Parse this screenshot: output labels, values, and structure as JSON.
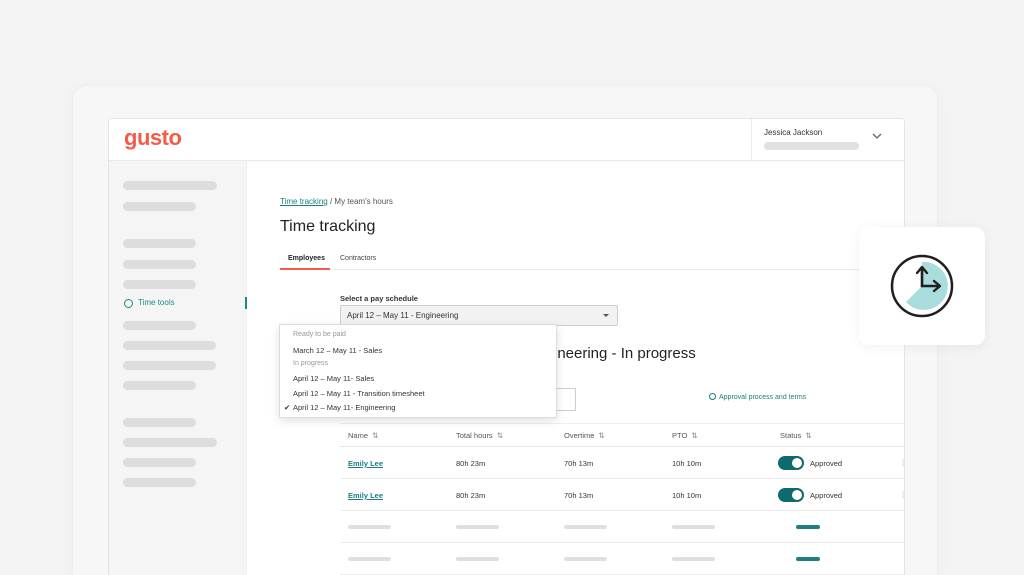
{
  "brand": {
    "logo_text": "gusto",
    "accent": "#f45d48",
    "teal": "#1a8080"
  },
  "header": {
    "user_name": "Jessica Jackson",
    "chevron_icon": "chevron-down-icon"
  },
  "sidebar": {
    "active_item": {
      "label": "Time tools",
      "icon": "clock-icon"
    }
  },
  "breadcrumb": {
    "link": "Time tracking",
    "separator": "/",
    "current": "My team's hours"
  },
  "page": {
    "title": "Time tracking"
  },
  "tabs": [
    {
      "label": "Employees",
      "active": true
    },
    {
      "label": "Contractors",
      "active": false
    }
  ],
  "pay_schedule": {
    "label": "Select a pay schedule",
    "selected": "April 12 – May 11 - Engineering"
  },
  "dropdown": {
    "groups": [
      {
        "heading": "Ready to be paid",
        "items": [
          "March 12 – May 11 - Sales"
        ]
      },
      {
        "heading": "In progress",
        "items": [
          "April 12 – May 11- Sales",
          "April 12 – May 11 - Transition timesheet",
          "April 12 – May 11- Engineering"
        ]
      }
    ],
    "checked": "April 12 – May 11- Engineering",
    "check_glyph": "✔"
  },
  "section": {
    "title": "ineering - In progress"
  },
  "approval_link": {
    "label": "Approval process and terms",
    "icon": "help-circle-icon"
  },
  "table": {
    "headers": [
      "Name",
      "Total hours",
      "Overtime",
      "PTO",
      "Status"
    ],
    "sort_glyph": "⇅",
    "rows": [
      {
        "name": "Emily Lee",
        "total_hours": "80h 23m",
        "overtime": "70h 13m",
        "pto": "10h 10m",
        "status": "Approved",
        "approved": true
      },
      {
        "name": "Emily Lee",
        "total_hours": "80h 23m",
        "overtime": "70h 13m",
        "pto": "10h 10m",
        "status": "Approved",
        "approved": true
      }
    ]
  }
}
